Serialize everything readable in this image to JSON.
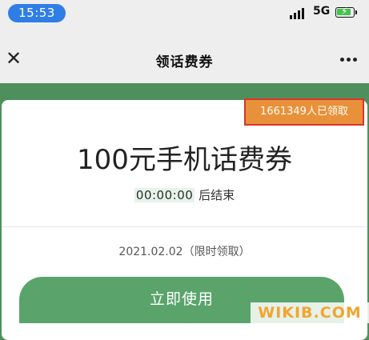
{
  "status_bar": {
    "time": "15:53",
    "network": "5G"
  },
  "nav": {
    "title": "领话费券",
    "close_icon": "close-icon",
    "more_icon": "more-icon"
  },
  "card": {
    "claimed_badge": "1661349人已领取",
    "coupon_title": "100元手机话费券",
    "countdown": "00:00:00",
    "countdown_suffix": "后结束",
    "date_info": "2021.02.02（限时领取）",
    "use_button": "立即使用"
  },
  "watermark": "WIKIB.COM",
  "colors": {
    "background_green": "#4f8f5e",
    "button_green": "#5aa46c",
    "badge_orange": "#e8913a",
    "badge_outline_red": "#d8342d",
    "time_pill_blue": "#2f7ee6"
  }
}
